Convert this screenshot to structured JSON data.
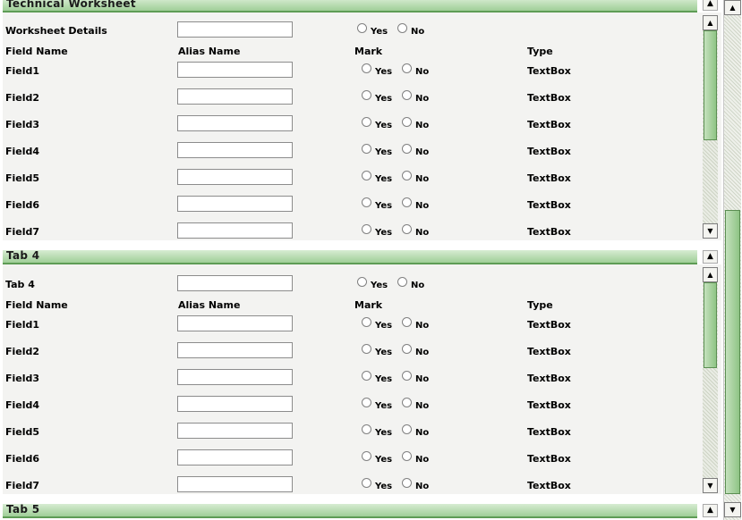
{
  "sections": [
    {
      "title": "Technical Worksheet",
      "top_label": "Worksheet Details",
      "yes_label": "Yes",
      "no_label": "No",
      "headers": {
        "field": "Field Name",
        "alias": "Alias Name",
        "mark": "Mark",
        "type": "Type"
      },
      "fields": [
        {
          "name": "Field1",
          "type": "TextBox"
        },
        {
          "name": "Field2",
          "type": "TextBox"
        },
        {
          "name": "Field3",
          "type": "TextBox"
        },
        {
          "name": "Field4",
          "type": "TextBox"
        },
        {
          "name": "Field5",
          "type": "TextBox"
        },
        {
          "name": "Field6",
          "type": "TextBox"
        },
        {
          "name": "Field7",
          "type": "TextBox"
        }
      ]
    },
    {
      "title": "Tab 4",
      "top_label": "Tab 4",
      "yes_label": "Yes",
      "no_label": "No",
      "headers": {
        "field": "Field Name",
        "alias": "Alias Name",
        "mark": "Mark",
        "type": "Type"
      },
      "fields": [
        {
          "name": "Field1",
          "type": "TextBox"
        },
        {
          "name": "Field2",
          "type": "TextBox"
        },
        {
          "name": "Field3",
          "type": "TextBox"
        },
        {
          "name": "Field4",
          "type": "TextBox"
        },
        {
          "name": "Field5",
          "type": "TextBox"
        },
        {
          "name": "Field6",
          "type": "TextBox"
        },
        {
          "name": "Field7",
          "type": "TextBox"
        }
      ]
    },
    {
      "title": "Tab 5"
    }
  ],
  "icons": {
    "collapse": "double-chevron-up-icon",
    "scroll_up": "arrow-up-icon",
    "scroll_down": "arrow-down-icon"
  },
  "colors": {
    "header_green": "#9fce97",
    "header_border": "#5e9c55",
    "panel_bg": "#f3f3f1",
    "thumb_green": "#8fc485"
  }
}
